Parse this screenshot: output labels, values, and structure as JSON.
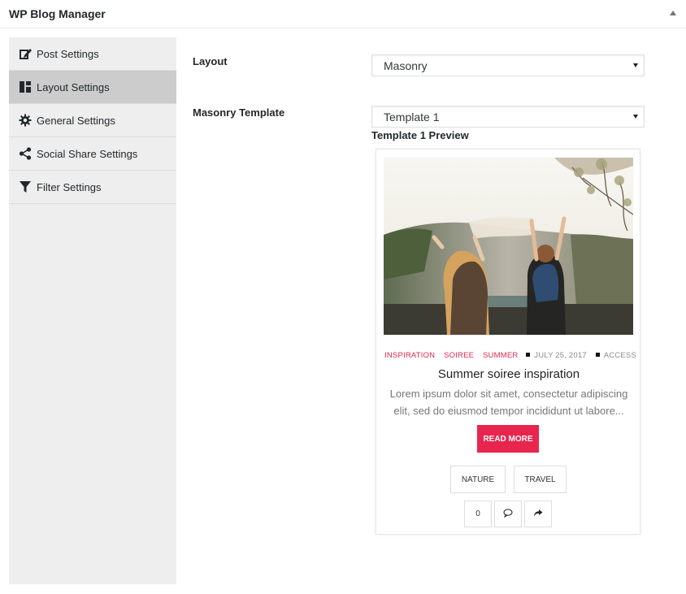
{
  "panel": {
    "title": "WP Blog Manager",
    "toggle_icon": "triangle-up-icon"
  },
  "sidebar": {
    "items": [
      {
        "label": "Post Settings",
        "icon": "edit-icon",
        "active": false
      },
      {
        "label": "Layout Settings",
        "icon": "layout-icon",
        "active": true
      },
      {
        "label": "General Settings",
        "icon": "gear-icon",
        "active": false
      },
      {
        "label": "Social Share Settings",
        "icon": "share-icon",
        "active": false
      },
      {
        "label": "Filter Settings",
        "icon": "filter-icon",
        "active": false
      }
    ]
  },
  "form": {
    "layout": {
      "label": "Layout",
      "value": "Masonry"
    },
    "template": {
      "label": "Masonry Template",
      "value": "Template 1"
    },
    "preview_label": "Template 1 Preview"
  },
  "preview": {
    "categories": [
      "INSPIRATION",
      "SOIREE",
      "SUMMER"
    ],
    "date": "JULY 25, 2017",
    "author": "ACCESS",
    "title": "Summer soiree inspiration",
    "excerpt": "Lorem ipsum dolor sit amet, consectetur adipiscing elit, sed do eiusmod tempor incididunt ut labore...",
    "read_more": "READ MORE",
    "tags": [
      "NATURE",
      "TRAVEL"
    ],
    "like_count": "0",
    "comment_icon": "comment-icon",
    "share_icon": "share-arrow-icon",
    "accent_color": "#e8254e"
  }
}
